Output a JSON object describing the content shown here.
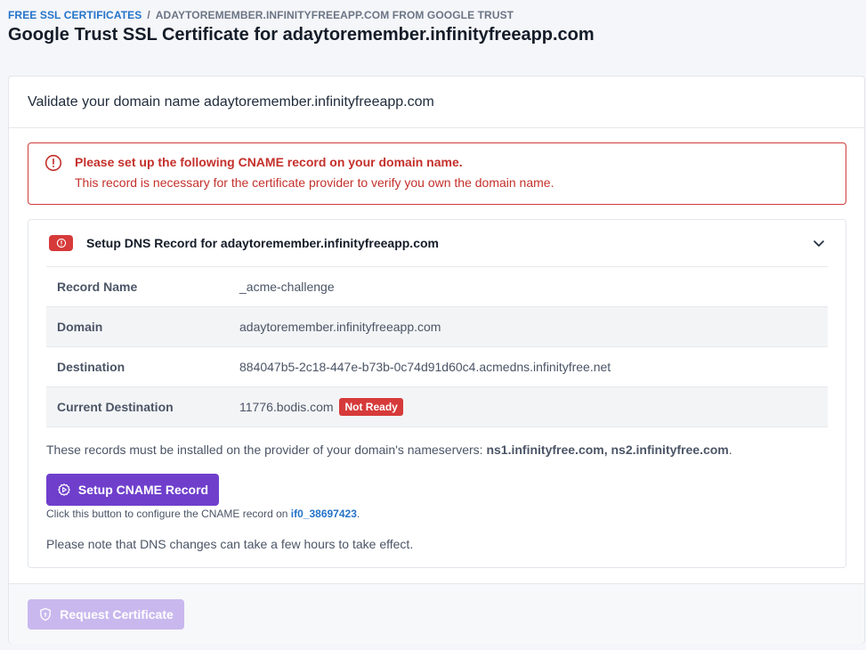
{
  "breadcrumb": {
    "root": "FREE SSL CERTIFICATES",
    "separator": "/",
    "current": "ADAYTOREMEMBER.INFINITYFREEAPP.COM FROM GOOGLE TRUST"
  },
  "page": {
    "title": "Google Trust SSL Certificate for adaytoremember.infinityfreeapp.com"
  },
  "card": {
    "header": "Validate your domain name adaytoremember.infinityfreeapp.com"
  },
  "alert": {
    "title": "Please set up the following CNAME record on your domain name.",
    "message": "This record is necessary for the certificate provider to verify you own the domain name.",
    "icon": "alert-circle-icon"
  },
  "dns": {
    "title": "Setup DNS Record for adaytoremember.infinityfreeapp.com",
    "records": [
      {
        "label": "Record Name",
        "value": "_acme-challenge"
      },
      {
        "label": "Domain",
        "value": "adaytoremember.infinityfreeapp.com"
      },
      {
        "label": "Destination",
        "value": "884047b5-2c18-447e-b73b-0c74d91d60c4.acmedns.infinityfree.net"
      },
      {
        "label": "Current Destination",
        "value": "11776.bodis.com",
        "status": "Not Ready"
      }
    ],
    "ns_note_prefix": "These records must be installed on the provider of your domain's nameservers: ",
    "nameservers": "ns1.infinityfree.com, ns2.infinityfree.com",
    "ns_note_suffix": ".",
    "setup_button": "Setup CNAME Record",
    "help_prefix": "Click this button to configure the CNAME record on ",
    "help_account": "if0_38697423",
    "help_suffix": ".",
    "propagation_note": "Please note that DNS changes can take a few hours to take effect."
  },
  "footer": {
    "request_button": "Request Certificate"
  },
  "colors": {
    "accent": "#6f3fcc",
    "danger": "#d63a3a",
    "link": "#2473c9",
    "disabled_button": "#c9b8ee"
  }
}
